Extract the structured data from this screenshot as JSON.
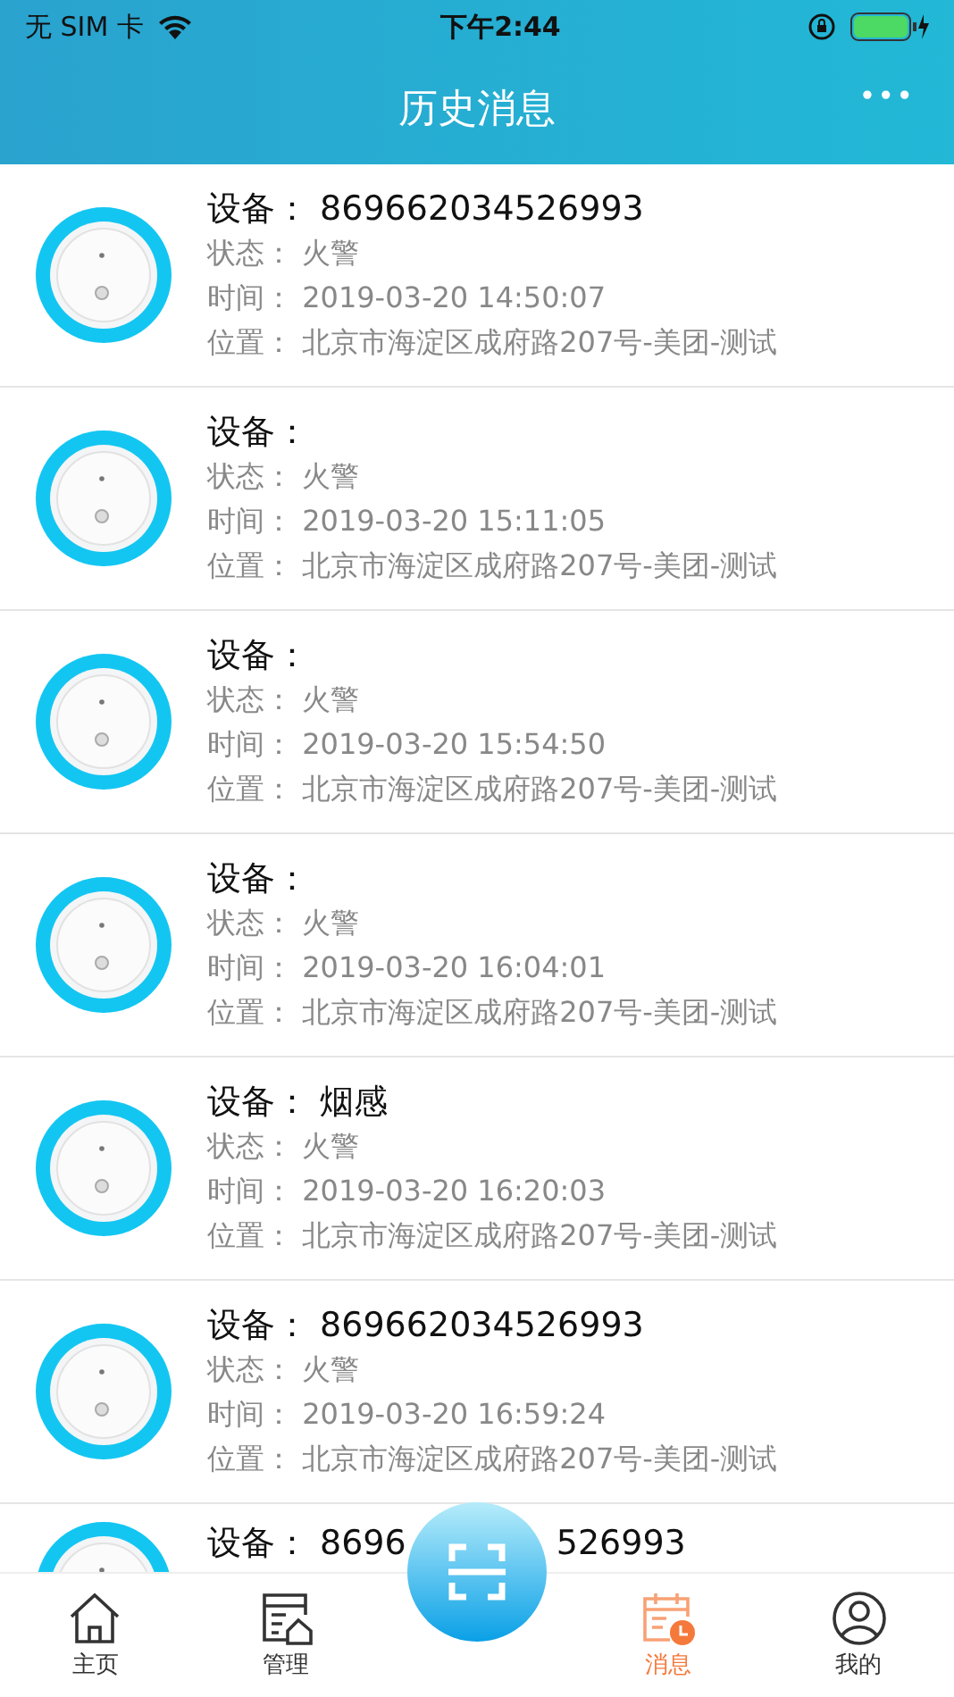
{
  "status_bar": {
    "carrier": "无 SIM 卡",
    "time": "下午2:44"
  },
  "header": {
    "title": "历史消息",
    "more": "•••"
  },
  "messages": [
    {
      "device_label": "设备：",
      "device": "869662034526993",
      "status_label": "状态：",
      "status": "火警",
      "time_label": "时间：",
      "time": "2019-03-20 14:50:07",
      "location_label": "位置：",
      "location": "北京市海淀区成府路207号-美团-测试"
    },
    {
      "device_label": "设备：",
      "status_label": "状态：",
      "status": "火警",
      "time_label": "时间：",
      "time": "2019-03-20 15:11:05",
      "location_label": "位置：",
      "location": "北京市海淀区成府路207号-美团-测试"
    },
    {
      "device_label": "设备：",
      "status_label": "状态：",
      "status": "火警",
      "time_label": "时间：",
      "time": "2019-03-20 15:54:50",
      "location_label": "位置：",
      "location": "北京市海淀区成府路207号-美团-测试"
    },
    {
      "device_label": "设备：",
      "status_label": "状态：",
      "status": "火警",
      "time_label": "时间：",
      "time": "2019-03-20 16:04:01",
      "location_label": "位置：",
      "location": "北京市海淀区成府路207号-美团-测试"
    },
    {
      "device_label": "设备：",
      "device": "烟感",
      "status_label": "状态：",
      "status": "火警",
      "time_label": "时间：",
      "time": "2019-03-20 16:20:03",
      "location_label": "位置：",
      "location": "北京市海淀区成府路207号-美团-测试"
    },
    {
      "device_label": "设备：",
      "device": "869662034526993",
      "status_label": "状态：",
      "status": "火警",
      "time_label": "时间：",
      "time": "2019-03-20 16:59:24",
      "location_label": "位置：",
      "location": "北京市海淀区成府路207号-美团-测试"
    },
    {
      "device_label": "设备：",
      "device_fragments": [
        "8696",
        "526993"
      ]
    }
  ],
  "tab_bar": [
    {
      "kind": "home",
      "label": "主页",
      "selected": false
    },
    {
      "kind": "manage",
      "label": "管理",
      "selected": false
    },
    {
      "kind": "scan",
      "selected": false
    },
    {
      "kind": "messages",
      "label": "消息",
      "selected": true
    },
    {
      "kind": "profile",
      "label": "我的",
      "selected": false
    }
  ]
}
